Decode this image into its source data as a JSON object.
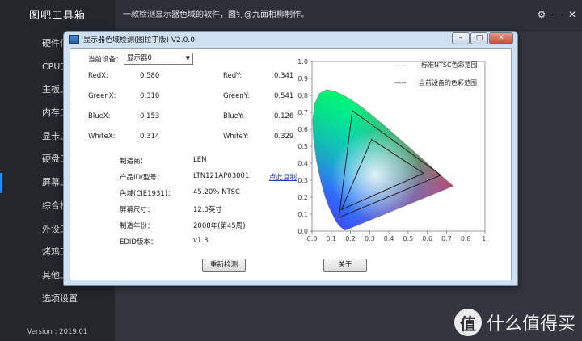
{
  "app": {
    "title": "图吧工具箱",
    "version": "Version : 2019.01",
    "notice": "一款检测显示器色域的软件，图钉@九面相柳制作。",
    "sidebar": [
      {
        "label": "硬件信",
        "active": false
      },
      {
        "label": "CPU工",
        "active": false
      },
      {
        "label": "主板工",
        "active": false
      },
      {
        "label": "内存工",
        "active": false
      },
      {
        "label": "显卡工",
        "active": false
      },
      {
        "label": "硬盘工",
        "active": false
      },
      {
        "label": "屏幕工",
        "active": true
      },
      {
        "label": "综合检",
        "active": false
      },
      {
        "label": "外设工",
        "active": false
      },
      {
        "label": "烤鸡工",
        "active": false
      },
      {
        "label": "其他工",
        "active": false
      },
      {
        "label": "选项设置",
        "active": false
      }
    ],
    "topbar_buttons": {
      "settings": "⚙",
      "minimize": "—",
      "close": "✕"
    },
    "watermark": {
      "badge": "值",
      "text": "什么值得买"
    }
  },
  "dialog": {
    "title": "显示器色域检测(图拉丁版) V2.0.0",
    "controls": {
      "minimize": "–",
      "maximize": "□",
      "close": "✕"
    },
    "device_label": "当前设备：",
    "device_value": "显示器0",
    "coords": [
      {
        "label": "RedX:",
        "value": "0.580"
      },
      {
        "label": "RedY:",
        "value": "0.341"
      },
      {
        "label": "GreenX:",
        "value": "0.310"
      },
      {
        "label": "GreenY:",
        "value": "0.541"
      },
      {
        "label": "BlueX:",
        "value": "0.153"
      },
      {
        "label": "BlueY:",
        "value": "0.126"
      },
      {
        "label": "WhiteX:",
        "value": "0.314"
      },
      {
        "label": "WhiteY:",
        "value": "0.329"
      }
    ],
    "info": [
      {
        "label": "制造商：",
        "value": "LEN"
      },
      {
        "label": "产品ID/型号：",
        "value": "LTN121AP03001"
      },
      {
        "label": "色域(CIE1931)：",
        "value": "45.20% NTSC"
      },
      {
        "label": "屏幕尺寸：",
        "value": "12.0英寸"
      },
      {
        "label": "制造年份：",
        "value": "2008年(第45周)"
      },
      {
        "label": "EDID版本：",
        "value": "v1.3"
      }
    ],
    "copy_link": "点此复制",
    "redetect_button": "重新检测",
    "about_button": "关于"
  },
  "chart_data": {
    "type": "scatter",
    "title": "",
    "x_ticks": [
      "0.0",
      "0.1",
      "0.2",
      "0.3",
      "0.4",
      "0.5",
      "0.6",
      "0.7",
      "0.8",
      "1."
    ],
    "y_ticks": [
      "1.0",
      "0.9",
      "0.8",
      "0.7",
      "0.6",
      "0.5",
      "0.4",
      "0.3",
      "0.2",
      "0.1",
      "0.0"
    ],
    "xlim": [
      0,
      0.9
    ],
    "ylim": [
      0,
      1.0
    ],
    "legend": [
      {
        "marker": "——",
        "label": "标准NTSC色彩范围"
      },
      {
        "marker": "-----",
        "label": "当前设备的色彩范围"
      }
    ],
    "ntsc_triangle": [
      [
        0.67,
        0.33
      ],
      [
        0.21,
        0.71
      ],
      [
        0.14,
        0.08
      ]
    ],
    "device_triangle": [
      [
        0.58,
        0.341
      ],
      [
        0.31,
        0.541
      ],
      [
        0.153,
        0.126
      ]
    ],
    "spectral_locus": [
      [
        0.1741,
        0.005
      ],
      [
        0.1733,
        0.0048
      ],
      [
        0.1726,
        0.0048
      ],
      [
        0.1714,
        0.0051
      ],
      [
        0.1689,
        0.0069
      ],
      [
        0.1644,
        0.0109
      ],
      [
        0.1566,
        0.0177
      ],
      [
        0.144,
        0.0297
      ],
      [
        0.1241,
        0.0578
      ],
      [
        0.0913,
        0.1327
      ],
      [
        0.0687,
        0.2007
      ],
      [
        0.0454,
        0.295
      ],
      [
        0.0235,
        0.4127
      ],
      [
        0.0082,
        0.5384
      ],
      [
        0.0039,
        0.6548
      ],
      [
        0.0139,
        0.7502
      ],
      [
        0.0389,
        0.812
      ],
      [
        0.0743,
        0.8338
      ],
      [
        0.1142,
        0.8262
      ],
      [
        0.1547,
        0.8059
      ],
      [
        0.1929,
        0.7816
      ],
      [
        0.2296,
        0.7543
      ],
      [
        0.2658,
        0.7243
      ],
      [
        0.3016,
        0.6923
      ],
      [
        0.3373,
        0.6589
      ],
      [
        0.3731,
        0.6245
      ],
      [
        0.4087,
        0.5896
      ],
      [
        0.4441,
        0.5547
      ],
      [
        0.4788,
        0.5202
      ],
      [
        0.5125,
        0.4866
      ],
      [
        0.5448,
        0.4544
      ],
      [
        0.5752,
        0.4242
      ],
      [
        0.6029,
        0.3965
      ],
      [
        0.627,
        0.3725
      ],
      [
        0.6482,
        0.3514
      ],
      [
        0.6658,
        0.334
      ],
      [
        0.6801,
        0.3197
      ],
      [
        0.6915,
        0.3083
      ],
      [
        0.7006,
        0.2993
      ],
      [
        0.714,
        0.2859
      ],
      [
        0.7347,
        0.2653
      ]
    ]
  }
}
